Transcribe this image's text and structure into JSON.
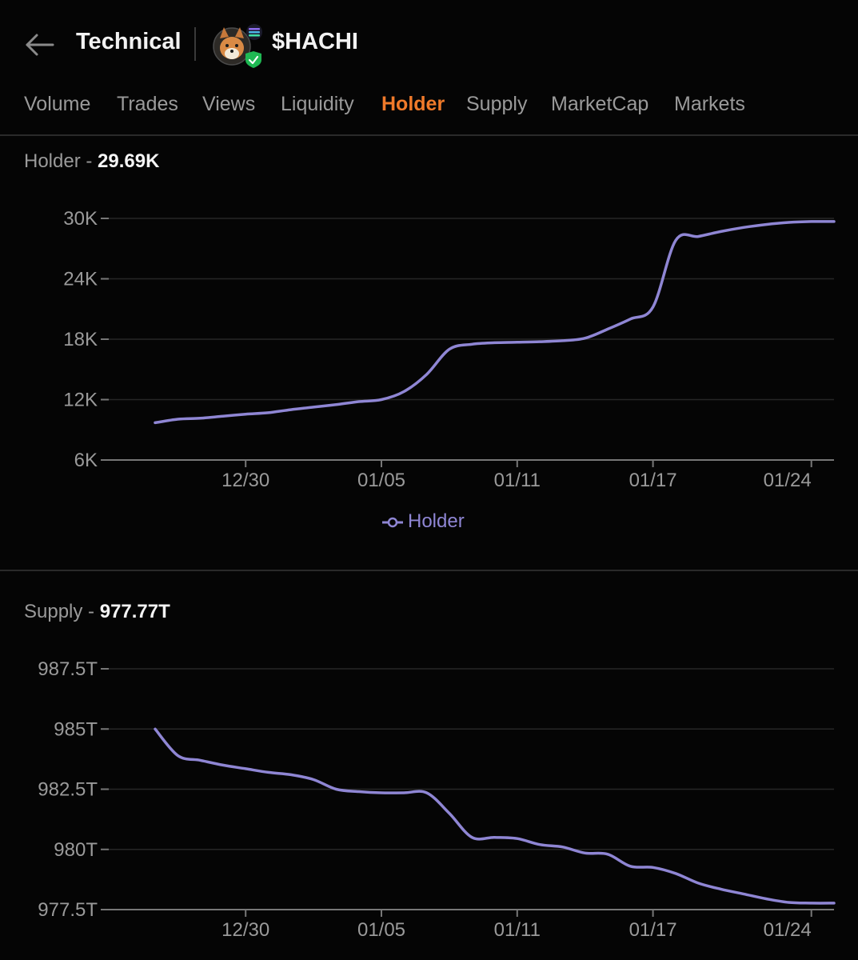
{
  "header": {
    "title": "Technical",
    "token_name": "$HACHI"
  },
  "tabs": [
    {
      "label": "Volume",
      "active": false
    },
    {
      "label": "Trades",
      "active": false
    },
    {
      "label": "Views",
      "active": false
    },
    {
      "label": "Liquidity",
      "active": false
    },
    {
      "label": "Holder",
      "active": true
    },
    {
      "label": "Supply",
      "active": false
    },
    {
      "label": "MarketCap",
      "active": false
    },
    {
      "label": "Markets",
      "active": false
    }
  ],
  "holder": {
    "title_prefix": "Holder - ",
    "title_value": "29.69K",
    "legend_label": "Holder"
  },
  "supply": {
    "title_prefix": "Supply - ",
    "title_value": "977.77T"
  },
  "colors": {
    "background": "#050505",
    "accent_active_tab": "#f07a2a",
    "series_line": "#8f86d4",
    "verified_badge": "#1fb853"
  },
  "chart_data": [
    {
      "type": "line",
      "title": "Holder - 29.69K",
      "series": [
        {
          "name": "Holder",
          "x": [
            "12/26",
            "12/27",
            "12/28",
            "12/29",
            "12/30",
            "12/31",
            "01/01",
            "01/02",
            "01/03",
            "01/04",
            "01/05",
            "01/06",
            "01/07",
            "01/08",
            "01/09",
            "01/10",
            "01/11",
            "01/12",
            "01/13",
            "01/14",
            "01/15",
            "01/16",
            "01/17",
            "01/18",
            "01/19",
            "01/20",
            "01/21",
            "01/22",
            "01/23",
            "01/24",
            "01/25"
          ],
          "values": [
            9700,
            10050,
            10150,
            10350,
            10550,
            10700,
            11000,
            11250,
            11500,
            11800,
            12000,
            12800,
            14500,
            17000,
            17500,
            17650,
            17700,
            17750,
            17850,
            18100,
            19000,
            20000,
            21200,
            27800,
            28200,
            28700,
            29100,
            29400,
            29600,
            29690,
            29690
          ]
        }
      ],
      "y_ticks": [
        "6K",
        "12K",
        "18K",
        "24K",
        "30K"
      ],
      "x_ticks": [
        "12/30",
        "01/05",
        "01/11",
        "01/17",
        "01/24"
      ],
      "ylim": [
        6000,
        30000
      ],
      "legend": "bottom-center",
      "grid": true
    },
    {
      "type": "line",
      "title": "Supply - 977.77T",
      "series": [
        {
          "x": [
            "12/26",
            "12/27",
            "12/28",
            "12/29",
            "12/30",
            "12/31",
            "01/01",
            "01/02",
            "01/03",
            "01/04",
            "01/05",
            "01/06",
            "01/07",
            "01/08",
            "01/09",
            "01/10",
            "01/11",
            "01/12",
            "01/13",
            "01/14",
            "01/15",
            "01/16",
            "01/17",
            "01/18",
            "01/19",
            "01/20",
            "01/21",
            "01/22",
            "01/23",
            "01/24",
            "01/25"
          ],
          "values": [
            985.0,
            983.9,
            983.7,
            983.5,
            983.35,
            983.2,
            983.1,
            982.9,
            982.5,
            982.4,
            982.35,
            982.35,
            982.35,
            981.5,
            980.5,
            980.5,
            980.45,
            980.2,
            980.1,
            979.85,
            979.8,
            979.3,
            979.25,
            979.0,
            978.6,
            978.35,
            978.15,
            977.95,
            977.8,
            977.77,
            977.77
          ]
        }
      ],
      "y_ticks": [
        "977.5T",
        "980T",
        "982.5T",
        "985T",
        "987.5T"
      ],
      "x_ticks": [
        "12/30",
        "01/05",
        "01/11",
        "01/17",
        "01/24"
      ],
      "ylim": [
        977.5,
        987.5
      ],
      "grid": true
    }
  ]
}
